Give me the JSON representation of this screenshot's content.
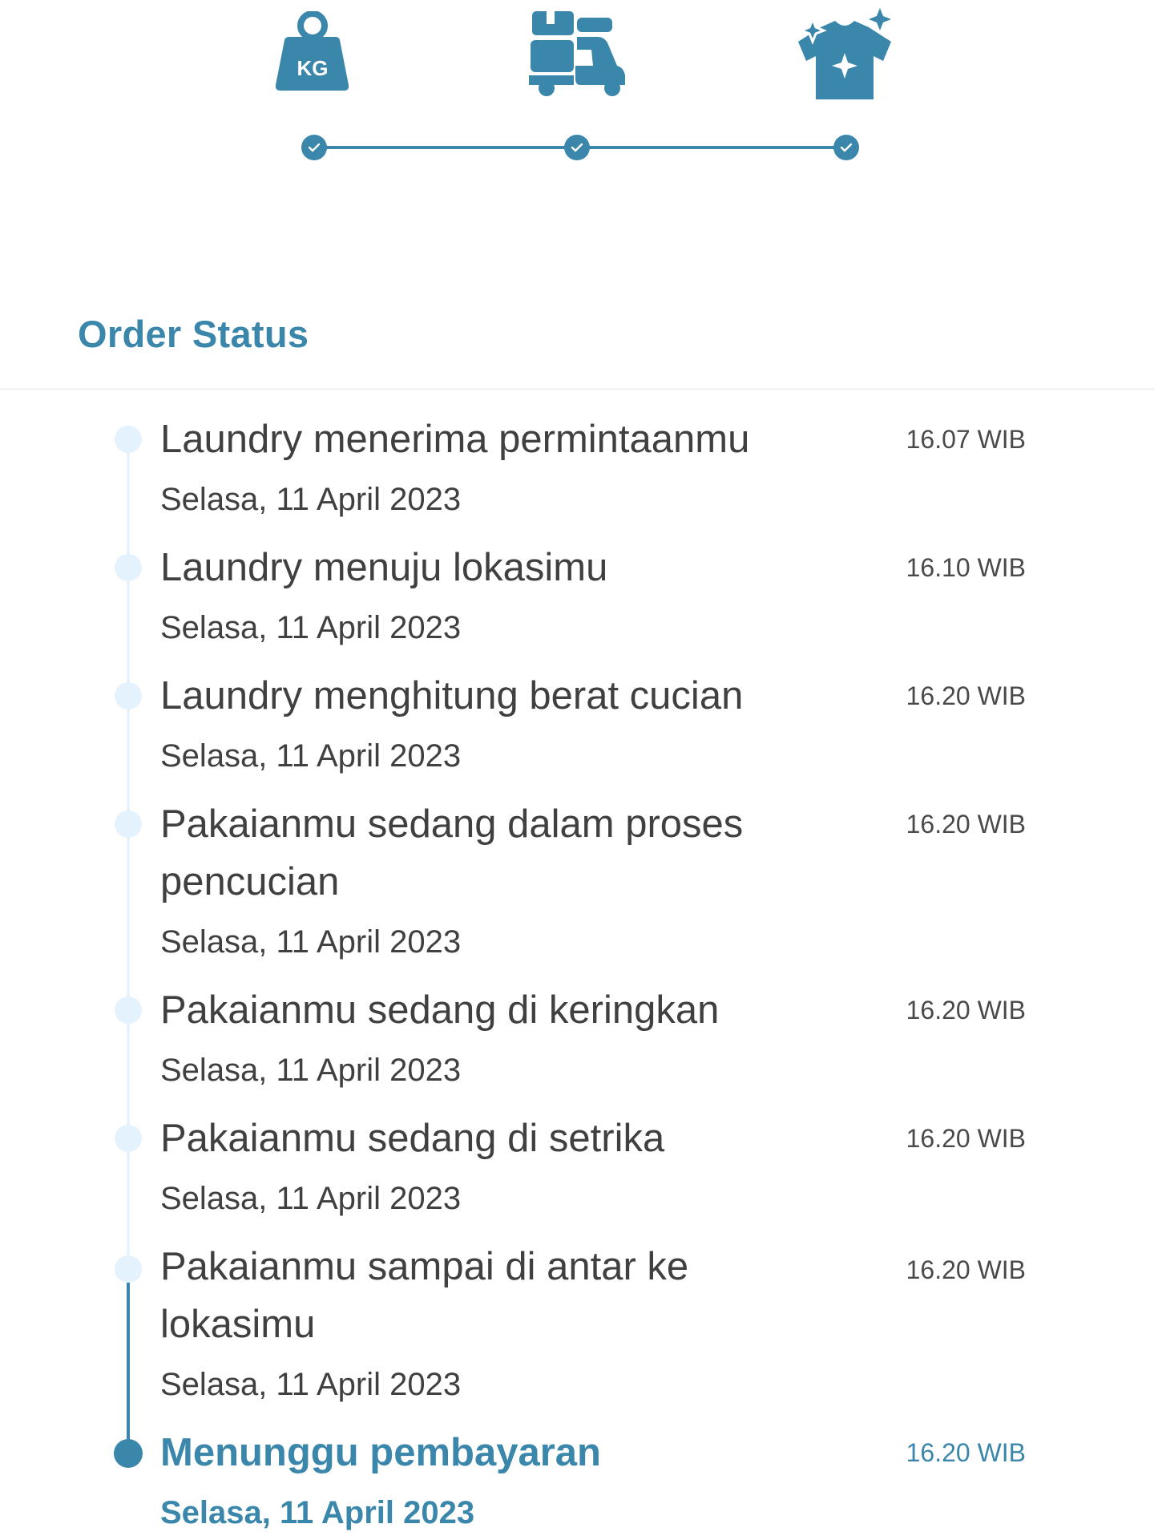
{
  "stepper": {
    "steps": [
      {
        "icon": "weight-kg-icon",
        "label": "KG",
        "done": true
      },
      {
        "icon": "delivery-scooter-icon",
        "done": true
      },
      {
        "icon": "clean-shirt-icon",
        "done": true
      }
    ],
    "color": "#3b87ab"
  },
  "page_title": "Order Status",
  "timeline": [
    {
      "title": "Laundry menerima permintaanmu",
      "date": "Selasa, 11 April 2023",
      "time": "16.07 WIB"
    },
    {
      "title": "Laundry menuju lokasimu",
      "date": "Selasa, 11 April 2023",
      "time": "16.10 WIB"
    },
    {
      "title": "Laundry menghitung berat cucian",
      "date": "Selasa, 11 April 2023",
      "time": "16.20 WIB"
    },
    {
      "title": "Pakaianmu sedang dalam proses pencucian",
      "date": "Selasa, 11 April 2023",
      "time": "16.20 WIB"
    },
    {
      "title": "Pakaianmu sedang di keringkan",
      "date": "Selasa, 11 April 2023",
      "time": "16.20 WIB"
    },
    {
      "title": "Pakaianmu sedang di setrika",
      "date": "Selasa, 11 April 2023",
      "time": "16.20 WIB"
    },
    {
      "title": "Pakaianmu sampai di antar ke lokasimu",
      "date": "Selasa, 11 April 2023",
      "time": "16.20 WIB"
    },
    {
      "title": "Menunggu pembayaran",
      "date": "Selasa, 11 April 2023",
      "time": "16.20 WIB",
      "active": true
    }
  ],
  "colors": {
    "accent": "#3b87ab",
    "inactive_dot": "#e3f2fc",
    "text": "#404040"
  }
}
